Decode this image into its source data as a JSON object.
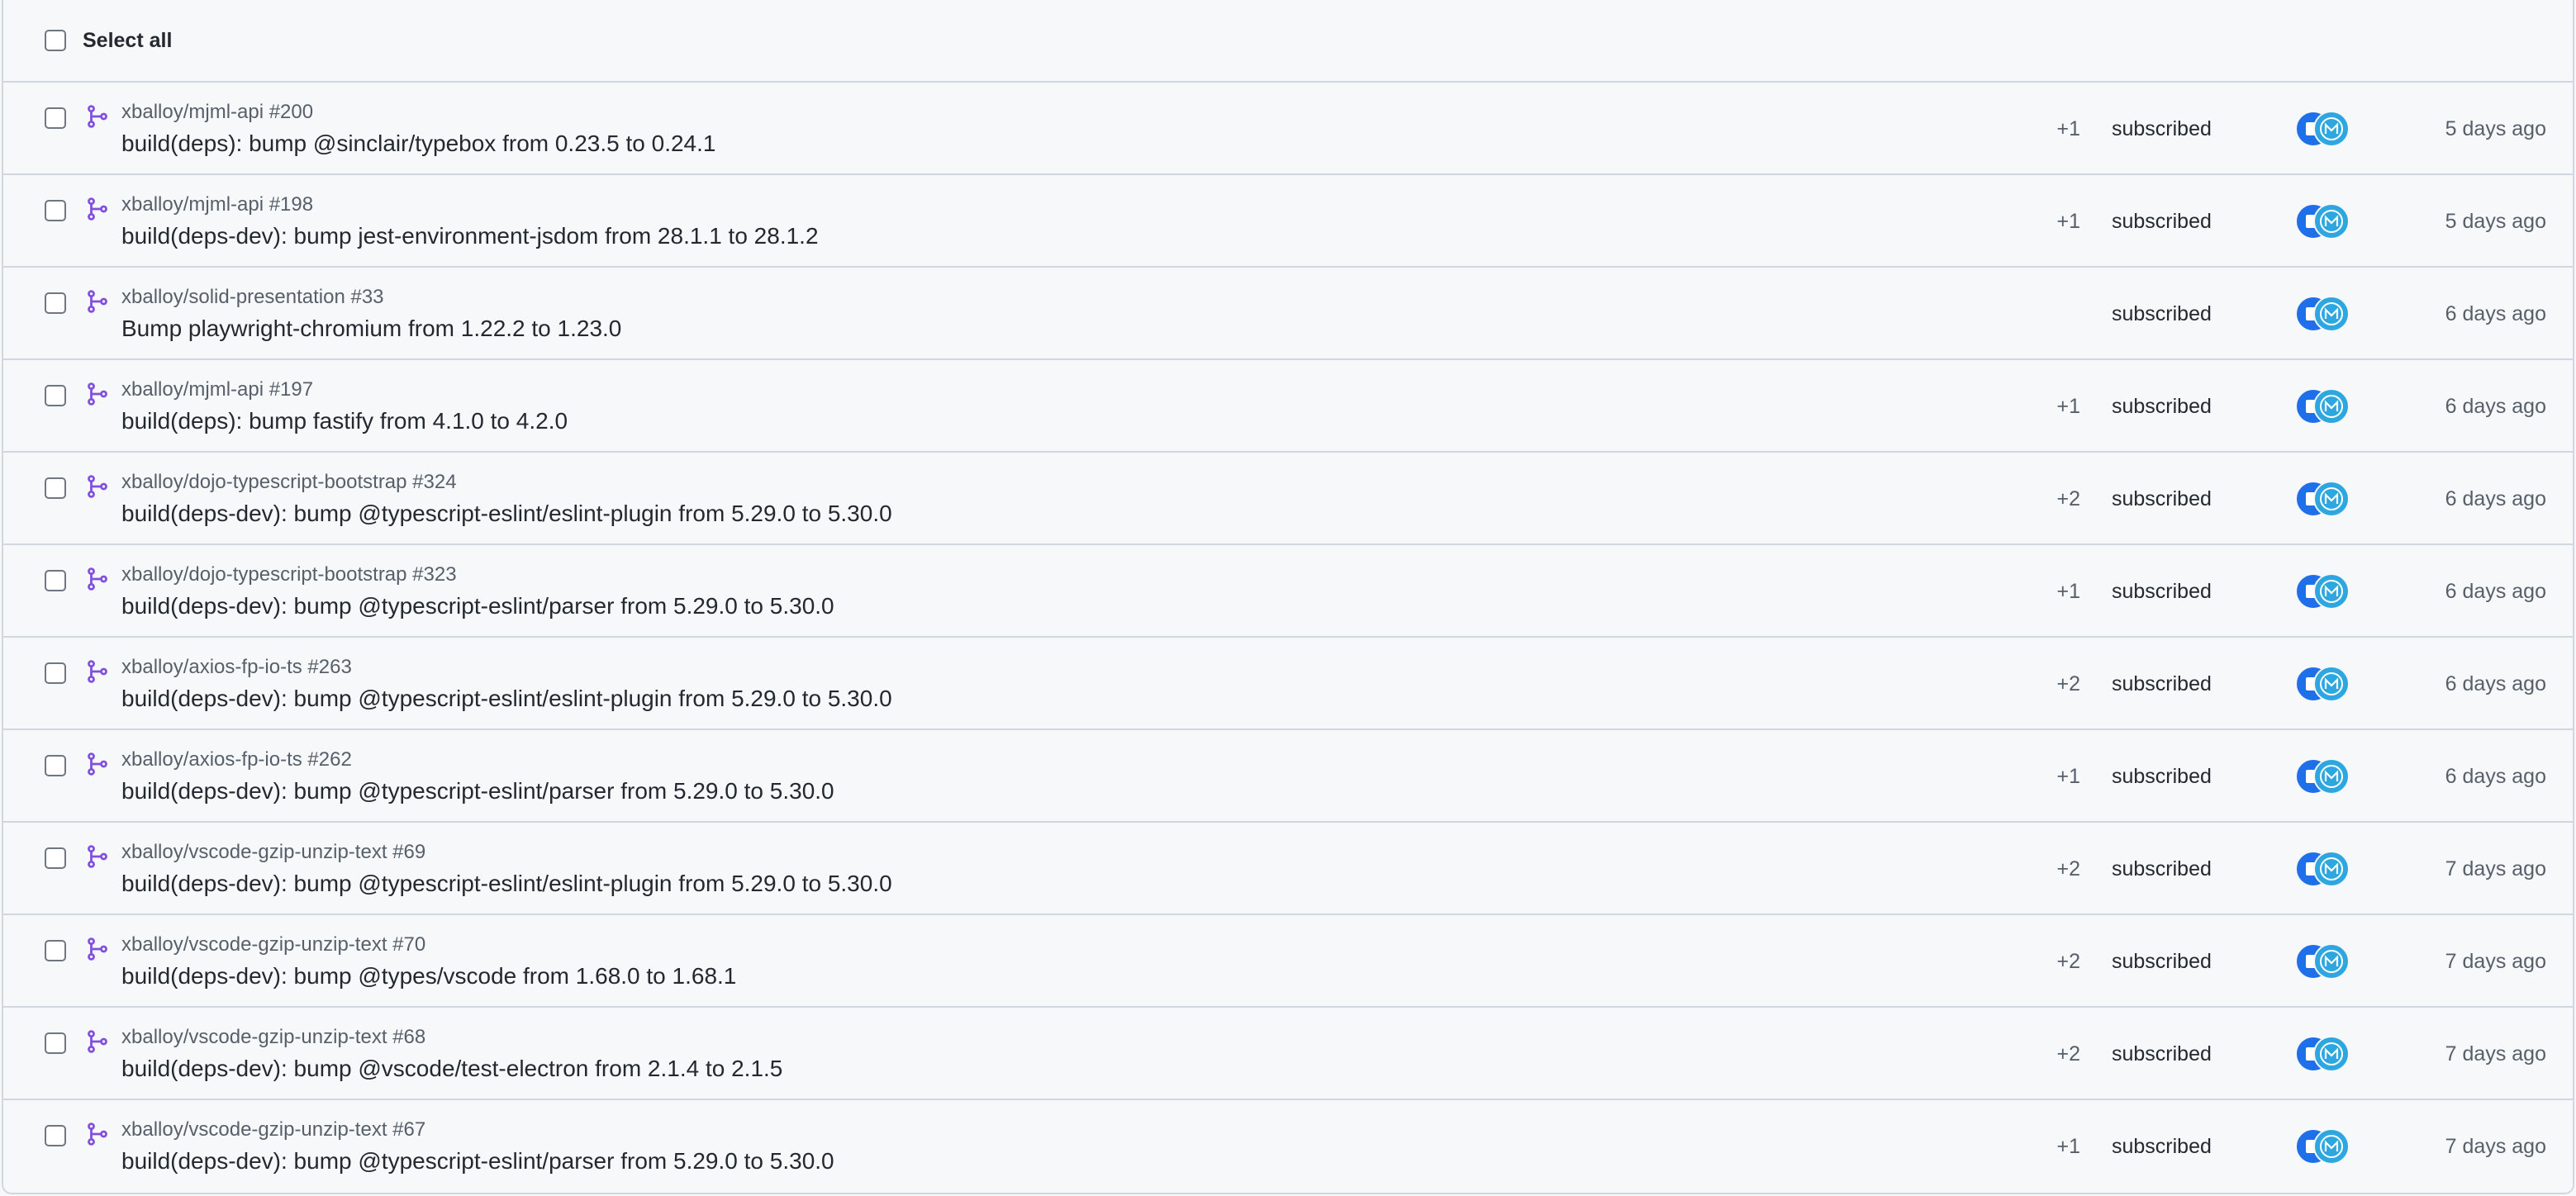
{
  "header": {
    "select_all_label": "Select all"
  },
  "colors": {
    "pr_icon": "#8250df",
    "avatar_primary": "#1f6feb",
    "avatar_secondary": "#2ea7e0"
  },
  "rows": [
    {
      "repo": "xballoy/mjml-api #200",
      "title": "build(deps): bump @sinclair/typebox from 0.23.5 to 0.24.1",
      "count": "+1",
      "reason": "subscribed",
      "time": "5 days ago"
    },
    {
      "repo": "xballoy/mjml-api #198",
      "title": "build(deps-dev): bump jest-environment-jsdom from 28.1.1 to 28.1.2",
      "count": "+1",
      "reason": "subscribed",
      "time": "5 days ago"
    },
    {
      "repo": "xballoy/solid-presentation #33",
      "title": "Bump playwright-chromium from 1.22.2 to 1.23.0",
      "count": "",
      "reason": "subscribed",
      "time": "6 days ago"
    },
    {
      "repo": "xballoy/mjml-api #197",
      "title": "build(deps): bump fastify from 4.1.0 to 4.2.0",
      "count": "+1",
      "reason": "subscribed",
      "time": "6 days ago"
    },
    {
      "repo": "xballoy/dojo-typescript-bootstrap #324",
      "title": "build(deps-dev): bump @typescript-eslint/eslint-plugin from 5.29.0 to 5.30.0",
      "count": "+2",
      "reason": "subscribed",
      "time": "6 days ago"
    },
    {
      "repo": "xballoy/dojo-typescript-bootstrap #323",
      "title": "build(deps-dev): bump @typescript-eslint/parser from 5.29.0 to 5.30.0",
      "count": "+1",
      "reason": "subscribed",
      "time": "6 days ago"
    },
    {
      "repo": "xballoy/axios-fp-io-ts #263",
      "title": "build(deps-dev): bump @typescript-eslint/eslint-plugin from 5.29.0 to 5.30.0",
      "count": "+2",
      "reason": "subscribed",
      "time": "6 days ago"
    },
    {
      "repo": "xballoy/axios-fp-io-ts #262",
      "title": "build(deps-dev): bump @typescript-eslint/parser from 5.29.0 to 5.30.0",
      "count": "+1",
      "reason": "subscribed",
      "time": "6 days ago"
    },
    {
      "repo": "xballoy/vscode-gzip-unzip-text #69",
      "title": "build(deps-dev): bump @typescript-eslint/eslint-plugin from 5.29.0 to 5.30.0",
      "count": "+2",
      "reason": "subscribed",
      "time": "7 days ago"
    },
    {
      "repo": "xballoy/vscode-gzip-unzip-text #70",
      "title": "build(deps-dev): bump @types/vscode from 1.68.0 to 1.68.1",
      "count": "+2",
      "reason": "subscribed",
      "time": "7 days ago"
    },
    {
      "repo": "xballoy/vscode-gzip-unzip-text #68",
      "title": "build(deps-dev): bump @vscode/test-electron from 2.1.4 to 2.1.5",
      "count": "+2",
      "reason": "subscribed",
      "time": "7 days ago"
    },
    {
      "repo": "xballoy/vscode-gzip-unzip-text #67",
      "title": "build(deps-dev): bump @typescript-eslint/parser from 5.29.0 to 5.30.0",
      "count": "+1",
      "reason": "subscribed",
      "time": "7 days ago"
    }
  ]
}
